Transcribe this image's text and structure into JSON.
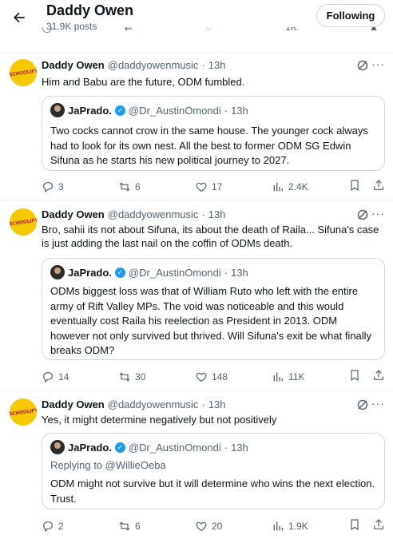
{
  "header": {
    "title": "Daddy Owen",
    "posts_count": "31.9K posts",
    "follow_label": "Following",
    "prev_views": "1K"
  },
  "avatar_logo_text": "SCHOOLIFY",
  "tweets": [
    {
      "author": "Daddy Owen",
      "handle": "@daddyowenmusic",
      "time": "13h",
      "text": "Him and Babu are the future,  ODM fumbled.",
      "quote": {
        "author": "JaPrado.",
        "handle": "@Dr_AustinOmondi",
        "time": "13h",
        "replying_to": "",
        "text": "Two cocks cannot crow in the same house. The younger cock always had to look for its own nest. All the best to former ODM SG Edwin Sifuna as he starts his new political journey to 2027."
      },
      "replies": "3",
      "reposts": "6",
      "likes": "17",
      "views": "2.4K"
    },
    {
      "author": "Daddy Owen",
      "handle": "@daddyowenmusic",
      "time": "13h",
      "text": "Bro, sahii its not about Sifuna, its about the death of Raila... Sifuna's case is just adding the last nail on the coffin of ODMs death.",
      "quote": {
        "author": "JaPrado.",
        "handle": "@Dr_AustinOmondi",
        "time": "13h",
        "replying_to": "",
        "text": "ODMs biggest loss was that of William Ruto who left with the entire army of Rift Valley MPs. The void was noticeable and this would eventually cost Raila his reelection as President in 2013. ODM however not only survived but thrived. Will Sifuna's exit be what finally breaks ODM?"
      },
      "replies": "14",
      "reposts": "30",
      "likes": "148",
      "views": "11K"
    },
    {
      "author": "Daddy Owen",
      "handle": "@daddyowenmusic",
      "time": "13h",
      "text": "Yes, it might determine negatively but not positively",
      "quote": {
        "author": "JaPrado.",
        "handle": "@Dr_AustinOmondi",
        "time": "13h",
        "replying_to": "Replying to @WillieOeba",
        "text": "ODM might not survive but it will determine who wins the next election. Trust."
      },
      "replies": "2",
      "reposts": "6",
      "likes": "20",
      "views": "1.9K"
    }
  ],
  "separator": "·",
  "more_glyph": "···",
  "colors": {
    "text": "#0f1419",
    "secondary": "#536471",
    "border": "#cfd9de",
    "verified": "#1d9bf0",
    "avatar_bg": "#f5c800"
  }
}
